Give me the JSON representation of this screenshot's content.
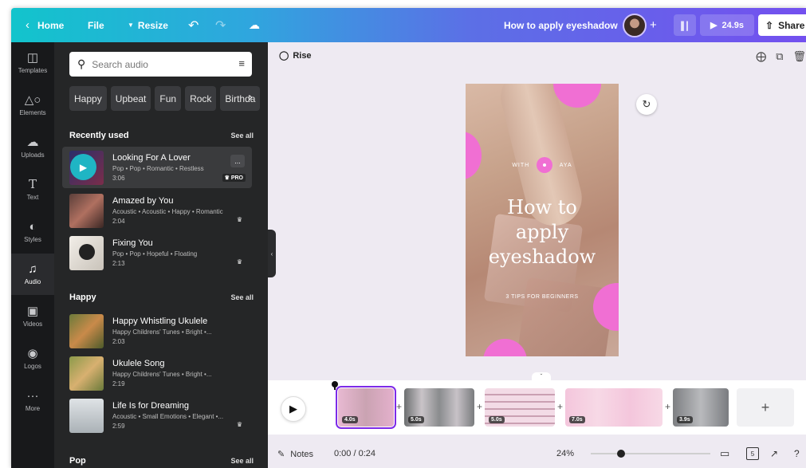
{
  "topbar": {
    "home_label": "Home",
    "file_label": "File",
    "resize_label": "Resize",
    "doc_title": "How to apply eyeshadow",
    "play_duration": "24.9s",
    "share_label": "Share"
  },
  "rail": [
    {
      "label": "Templates",
      "icon": "templates-icon"
    },
    {
      "label": "Elements",
      "icon": "elements-icon"
    },
    {
      "label": "Uploads",
      "icon": "uploads-icon"
    },
    {
      "label": "Text",
      "icon": "text-icon"
    },
    {
      "label": "Styles",
      "icon": "styles-icon"
    },
    {
      "label": "Audio",
      "icon": "audio-icon"
    },
    {
      "label": "Videos",
      "icon": "videos-icon"
    },
    {
      "label": "Logos",
      "icon": "logos-icon"
    },
    {
      "label": "More",
      "icon": "more-icon"
    }
  ],
  "audio_panel": {
    "search_placeholder": "Search audio",
    "chips": [
      "Happy",
      "Upbeat",
      "Fun",
      "Rock",
      "Birthda"
    ],
    "sections": [
      {
        "title": "Recently used",
        "see_all": "See all"
      },
      {
        "title": "Happy",
        "see_all": "See all"
      },
      {
        "title": "Pop",
        "see_all": "See all"
      }
    ],
    "tracks": [
      {
        "title": "Looking For A Lover",
        "meta": "Pop • Pop • Romantic • Restless",
        "duration": "3:06",
        "badge": "PRO",
        "more": "..."
      },
      {
        "title": "Amazed by You",
        "meta": "Acoustic • Acoustic • Happy • Romantic",
        "duration": "2:04"
      },
      {
        "title": "Fixing You",
        "meta": "Pop • Pop • Hopeful • Floating",
        "duration": "2:13"
      },
      {
        "title": "Happy Whistling Ukulele",
        "meta": "Happy Childrens' Tunes • Bright •...",
        "duration": "2:03"
      },
      {
        "title": "Ukulele Song",
        "meta": "Happy Childrens' Tunes • Bright •...",
        "duration": "2:19"
      },
      {
        "title": "Life Is for Dreaming",
        "meta": "Acoustic • Small Emotions • Elegant •...",
        "duration": "2:59"
      }
    ]
  },
  "canvas": {
    "animation_label": "Rise",
    "with_left": "WITH",
    "with_right": "AYA",
    "title_line1": "How to",
    "title_line2": "apply",
    "title_line3": "eyeshadow",
    "subtitle": "3 TIPS FOR BEGINNERS"
  },
  "timeline": {
    "clips": [
      "4.0s",
      "5.0s",
      "5.0s",
      "7.0s",
      "3.9s"
    ]
  },
  "footer": {
    "notes_label": "Notes",
    "time": "0:00 / 0:24",
    "zoom": "24%",
    "zoom_level": 0.25,
    "pages_count": "5"
  },
  "colors": {
    "accent_pink": "#f06fd3",
    "selection": "#7d2ae8",
    "panel_bg": "#252627"
  }
}
